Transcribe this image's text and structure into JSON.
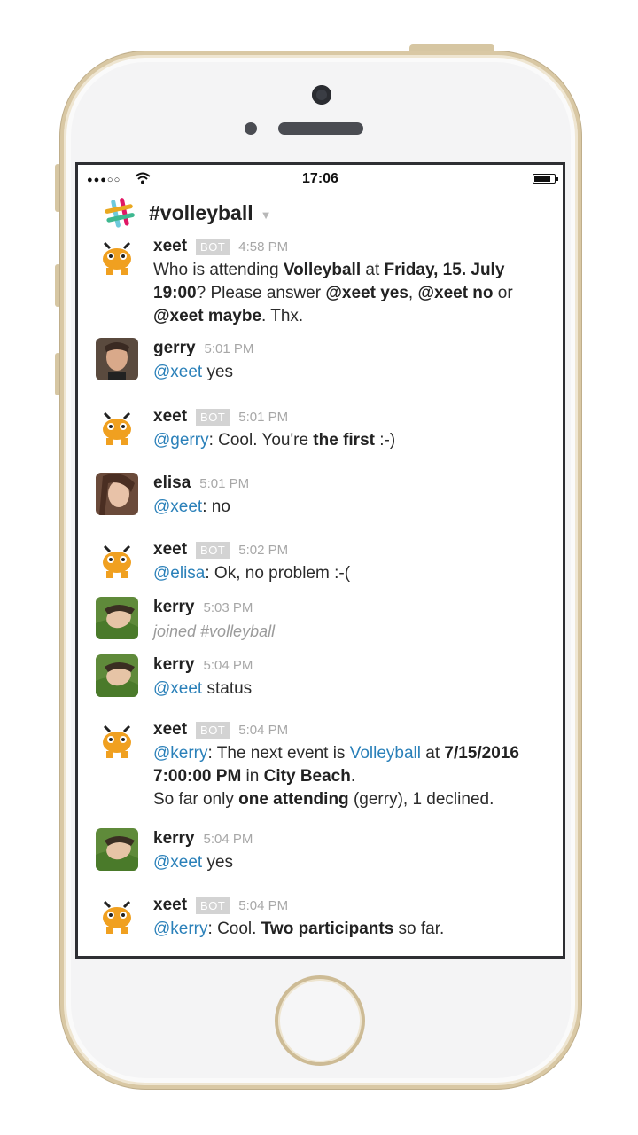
{
  "status_bar": {
    "signal": "●●●○○",
    "time": "17:06"
  },
  "channel": {
    "name": "#volleyball"
  },
  "messages": [
    {
      "author": "xeet",
      "badge": "BOT",
      "time": "4:58 PM",
      "t1": "Who is attending ",
      "b1": "Volleyball",
      "t2": " at ",
      "b2": "Friday, 15. July 19:00",
      "t3": "? Please answer ",
      "b3": "@xeet yes",
      "t4": ", ",
      "b4": "@xeet no",
      "t5": " or ",
      "b5": "@xeet maybe",
      "t6": ". Thx."
    },
    {
      "author": "gerry",
      "time": "5:01 PM",
      "mention": "@xeet",
      "text": " yes"
    },
    {
      "author": "xeet",
      "badge": "BOT",
      "time": "5:01 PM",
      "mention": "@gerry",
      "t1": ": Cool. You're ",
      "b1": "the first",
      "t2": " :-)"
    },
    {
      "author": "elisa",
      "time": "5:01 PM",
      "mention": "@xeet",
      "text": ": no"
    },
    {
      "author": "xeet",
      "badge": "BOT",
      "time": "5:02 PM",
      "mention": "@elisa",
      "text": ": Ok, no problem :-("
    },
    {
      "author": "kerry",
      "time": "5:03 PM",
      "text": "joined #volleyball"
    },
    {
      "author": "kerry",
      "time": "5:04 PM",
      "mention": "@xeet",
      "text": " status"
    },
    {
      "author": "xeet",
      "badge": "BOT",
      "time": "5:04 PM",
      "mention": "@kerry",
      "t1": ": The next event is ",
      "link": "Volleyball",
      "t2": " at ",
      "b1": "7/15/2016 7:00:00 PM",
      "t3": " in ",
      "b2": "City Beach",
      "t4": ".",
      "t5": "So far only ",
      "b3": "one attending",
      "t6": " (gerry), 1 declined."
    },
    {
      "author": "kerry",
      "time": "5:04 PM",
      "mention": "@xeet",
      "text": " yes"
    },
    {
      "author": "xeet",
      "badge": "BOT",
      "time": "5:04 PM",
      "mention": "@kerry",
      "t1": ": Cool. ",
      "b1": "Two participants",
      "t2": " so far."
    }
  ],
  "colors": {
    "mention": "#2a80b9",
    "bot_badge": "#d3d3d3",
    "phone_trim": "#d9c8a4"
  },
  "icons": {
    "wifi": "wifi-icon",
    "battery": "battery-icon",
    "channel_logo": "slack-logo-icon",
    "chevron": "chevron-down-icon"
  }
}
